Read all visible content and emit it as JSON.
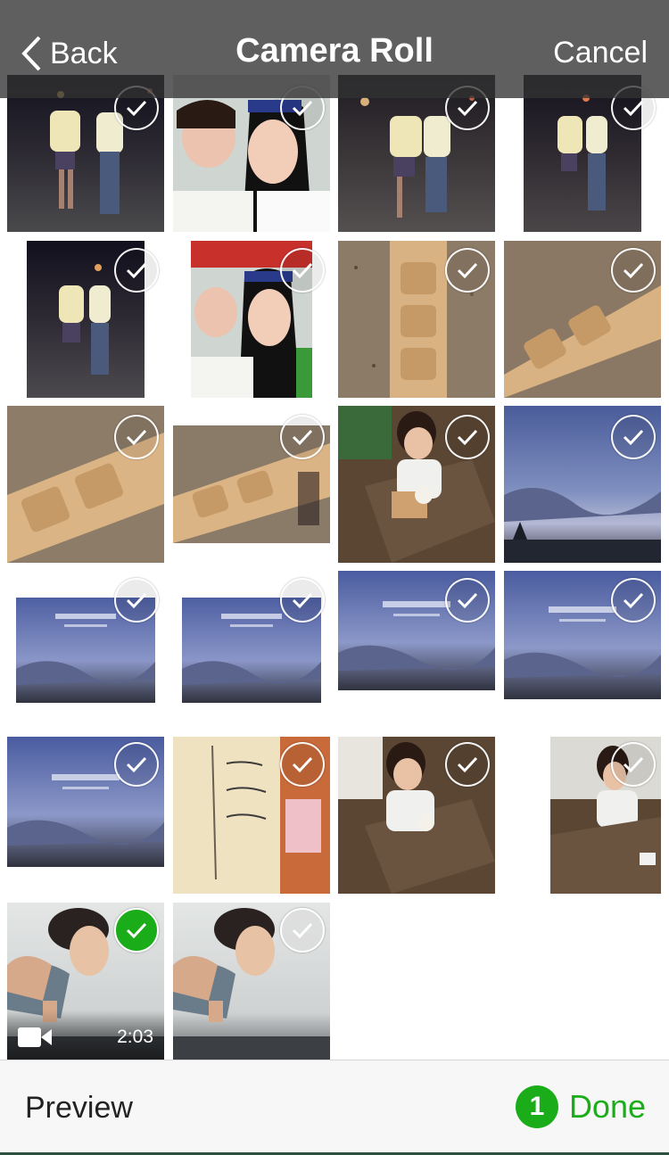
{
  "navbar": {
    "back_label": "Back",
    "title": "Camera Roll",
    "cancel_label": "Cancel"
  },
  "toolbar": {
    "preview_label": "Preview",
    "done_count": "1",
    "done_label": "Done"
  },
  "photos": [
    {
      "subject": "night-walk",
      "state": "unselected"
    },
    {
      "subject": "selfie",
      "state": "unselected"
    },
    {
      "subject": "night-walk",
      "state": "unselected"
    },
    {
      "subject": "night-walk",
      "state": "unselected"
    },
    {
      "subject": "night-walk",
      "state": "unselected"
    },
    {
      "subject": "selfie",
      "state": "unselected"
    },
    {
      "subject": "mooncake-mold",
      "state": "unselected"
    },
    {
      "subject": "mooncake-mold",
      "state": "unselected"
    },
    {
      "subject": "mooncake-mold",
      "state": "unselected"
    },
    {
      "subject": "mooncake-mold",
      "state": "unselected"
    },
    {
      "subject": "cafe",
      "state": "unselected"
    },
    {
      "subject": "sky",
      "state": "unselected"
    },
    {
      "subject": "sky-card",
      "state": "unselected"
    },
    {
      "subject": "sky-card",
      "state": "unselected"
    },
    {
      "subject": "sky-card",
      "state": "unselected"
    },
    {
      "subject": "sky-card",
      "state": "unselected"
    },
    {
      "subject": "sky-card",
      "state": "unselected"
    },
    {
      "subject": "handwritten-note",
      "state": "unselected"
    },
    {
      "subject": "cafe",
      "state": "unselected"
    },
    {
      "subject": "cafe",
      "state": "unselected"
    },
    {
      "subject": "workout-video",
      "state": "selected",
      "duration": "2:03"
    },
    {
      "subject": "workout",
      "state": "disabled"
    }
  ],
  "colors": {
    "accent": "#1aad19",
    "navbar": "#323232",
    "toolbar": "#f7f7f7"
  }
}
